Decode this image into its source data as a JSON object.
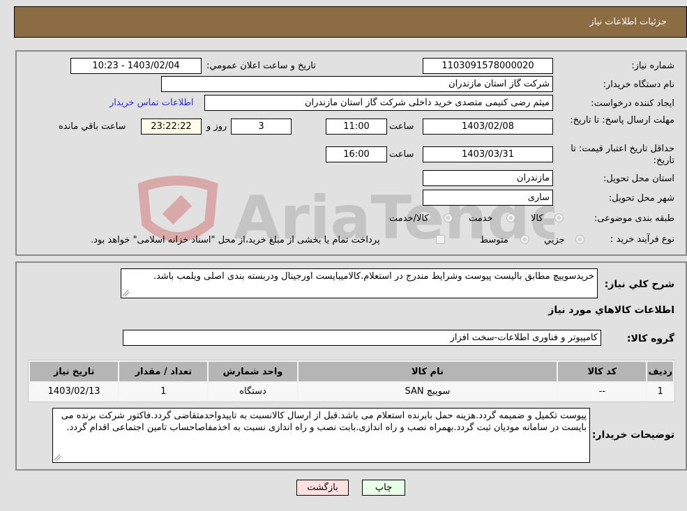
{
  "header": {
    "title": "جزئیات اطلاعات نیاز"
  },
  "form": {
    "need_number": {
      "label": "شماره نیاز:",
      "value": "1103091578000020"
    },
    "announce_datetime": {
      "label": "تاریخ و ساعت اعلان عمومي:",
      "value": "1403/02/04 - 10:23"
    },
    "buyer_org": {
      "label": "نام دستگاه خریدار:",
      "value": "شرکت گاز استان مازندران"
    },
    "requester": {
      "label": "ایجاد کننده درخواست:",
      "value": "میثم رضی کنیمی متصدی خرید داخلی شرکت گاز استان مازندران"
    },
    "buyer_contact_link": "اطلاعات تماس خریدار",
    "response_deadline": {
      "label": "مهلت ارسال پاسخ: تا تاریخ:",
      "date": "1403/02/08",
      "time_label": "ساعت",
      "time": "11:00",
      "days": "3",
      "days_label": "روز و",
      "remaining": "23:22:22",
      "remaining_label": "ساعت باقي مانده"
    },
    "price_validity": {
      "label": "حداقل تاریخ اعتبار قیمت: تا تاریخ:",
      "date": "1403/03/31",
      "time_label": "ساعت",
      "time": "16:00"
    },
    "delivery_province": {
      "label": "استان محل تحویل:",
      "value": "مازندران"
    },
    "delivery_city": {
      "label": "شهر محل تحویل:",
      "value": "ساری"
    },
    "category": {
      "label": "طبقه بندی موضوعی:",
      "options": [
        "کالا",
        "خدمت",
        "کالا/خدمت"
      ]
    },
    "purchase_type": {
      "label": "نوع فرآیند خرید :",
      "options": [
        "جزيي",
        "متوسط"
      ],
      "payment_note": "پرداخت تمام یا بخشی از مبلغ خرید،از محل \"اسناد خزانه اسلامی\" خواهد بود."
    }
  },
  "details": {
    "description_label": "شرح كلي نياز:",
    "description": "خریدسوییچ مطابق بالیست پیوست وشرایط مندرج در استعلام.کالامیبایست اورجینال ودربسته بندی اصلی ویلمب باشد.",
    "items_heading": "اطلاعات كالاهاي مورد نياز",
    "goods_group_label": "گروه کالا:",
    "goods_group": "کامپیوتر و فناوری اطلاعات-سخت افزار",
    "table": {
      "headers": [
        "ردیف",
        "کد کالا",
        "نام کالا",
        "واحد شمارش",
        "تعداد / مقدار",
        "تاریخ نیاز"
      ],
      "rows": [
        [
          "1",
          "--",
          "سوییچ SAN",
          "دستگاه",
          "1",
          "1403/02/13"
        ]
      ]
    },
    "buyer_notes_label": "توضیحات خریدار:",
    "buyer_notes": "پیوست تکمیل و ضمیمه گردد.هزینه حمل بابرنده استعلام می باشد.قبل از ارسال کالانسبت به تاییدواحدمتقاضی گردد.فاکتور شرکت برنده می بایست در سامانه مودیان ثبت گردد.بهمراه نصب و راه اندازی.بابت نصب و راه اندازی نسبت به اخذمفاصاحساب تامین اجتماعی اقدام گردد."
  },
  "buttons": {
    "print": "چاپ",
    "back": "بازگشت"
  },
  "watermark": {
    "text": "AriaTender.neT"
  }
}
